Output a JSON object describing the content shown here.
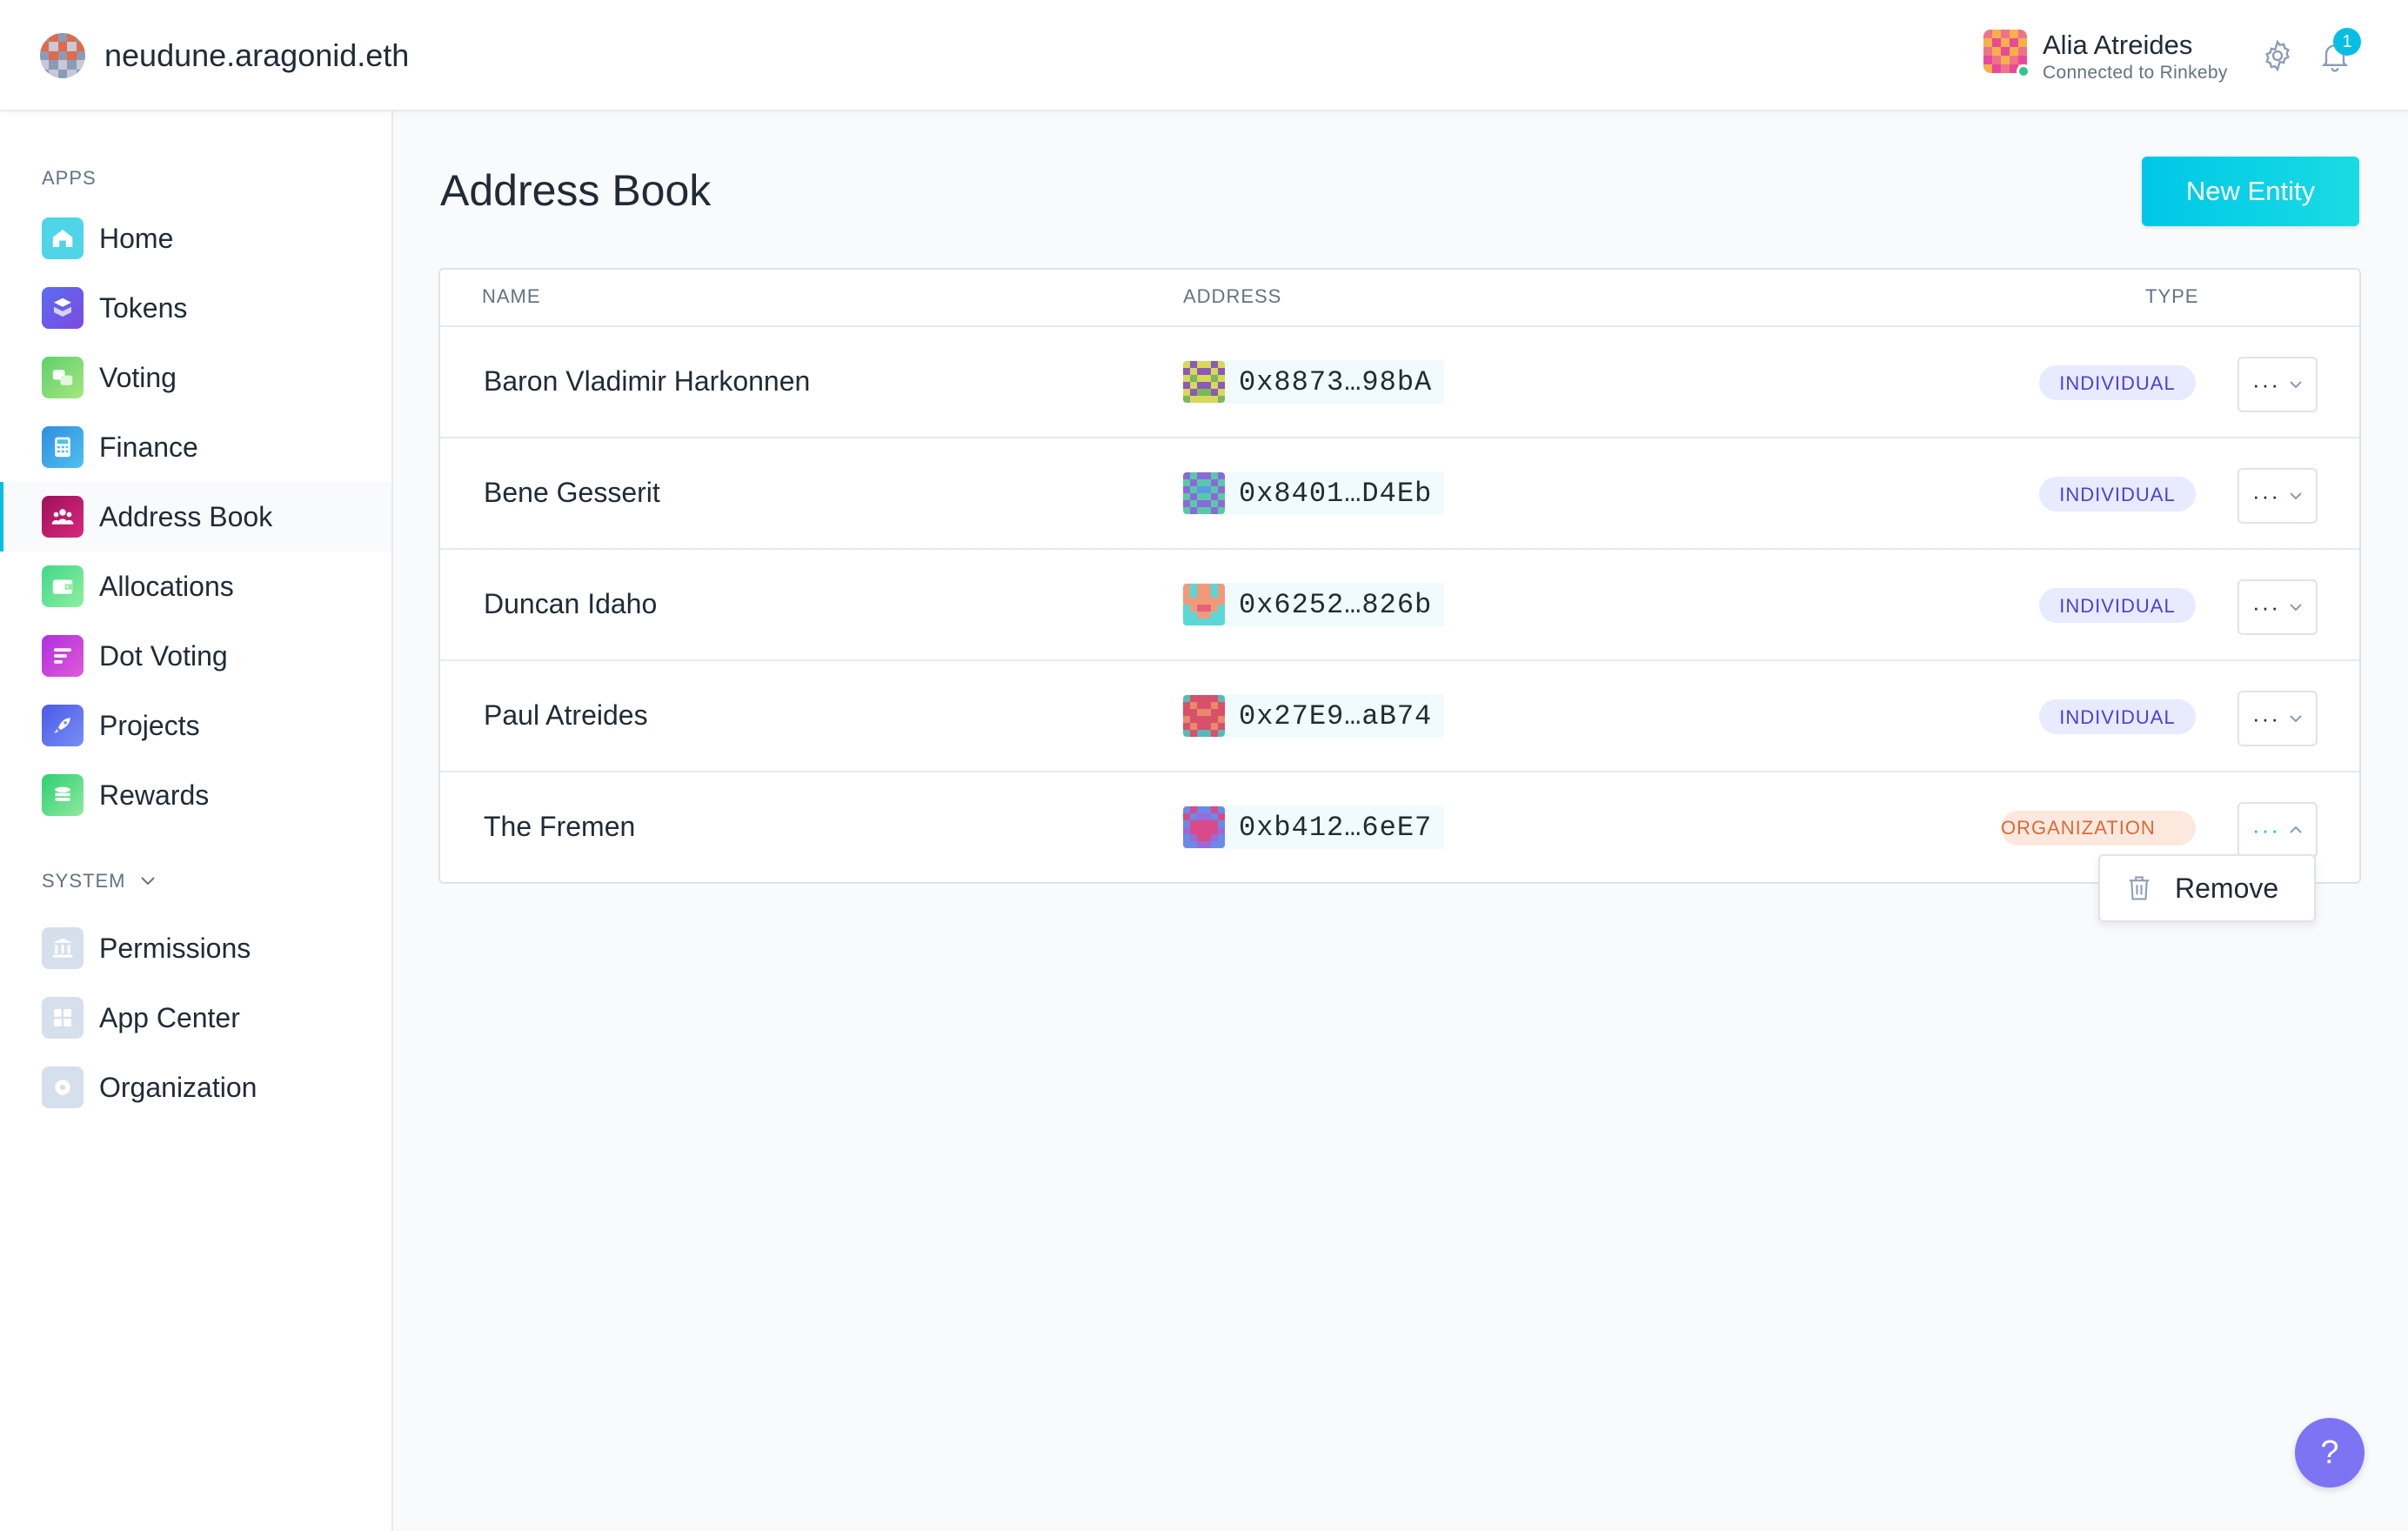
{
  "header": {
    "org_name": "neudune.aragonid.eth",
    "account_name": "Alia Atreides",
    "account_status": "Connected to Rinkeby",
    "notification_count": "1"
  },
  "sidebar": {
    "apps_label": "APPS",
    "system_label": "SYSTEM",
    "apps": [
      {
        "label": "Home",
        "icon": "home-icon",
        "color": "#4fd4e8"
      },
      {
        "label": "Tokens",
        "icon": "tokens-icon",
        "color": "#6a5af0"
      },
      {
        "label": "Voting",
        "icon": "voting-icon",
        "color": "#7ddc7a"
      },
      {
        "label": "Finance",
        "icon": "finance-icon",
        "color": "#3fa7e8"
      },
      {
        "label": "Address Book",
        "icon": "address-book-icon",
        "color": "#c0166e"
      },
      {
        "label": "Allocations",
        "icon": "allocations-icon",
        "color": "#4fe08a"
      },
      {
        "label": "Dot Voting",
        "icon": "dot-voting-icon",
        "color": "#c93ce0"
      },
      {
        "label": "Projects",
        "icon": "projects-icon",
        "color": "#5b6cf0"
      },
      {
        "label": "Rewards",
        "icon": "rewards-icon",
        "color": "#3ed67a"
      }
    ],
    "system": [
      {
        "label": "Permissions",
        "icon": "permissions-icon"
      },
      {
        "label": "App Center",
        "icon": "app-center-icon"
      },
      {
        "label": "Organization",
        "icon": "organization-icon"
      }
    ],
    "active": "Address Book"
  },
  "main": {
    "title": "Address Book",
    "new_button": "New Entity",
    "columns": {
      "name": "NAME",
      "address": "ADDRESS",
      "type": "TYPE"
    },
    "rows": [
      {
        "name": "Baron Vladimir Harkonnen",
        "address": "0x8873…98bA",
        "type": "INDIVIDUAL"
      },
      {
        "name": "Bene Gesserit",
        "address": "0x8401…D4Eb",
        "type": "INDIVIDUAL"
      },
      {
        "name": "Duncan Idaho",
        "address": "0x6252…826b",
        "type": "INDIVIDUAL"
      },
      {
        "name": "Paul Atreides",
        "address": "0x27E9…aB74",
        "type": "INDIVIDUAL"
      },
      {
        "name": "The Fremen",
        "address": "0xb412…6eE7",
        "type": "ORGANIZATION"
      }
    ],
    "context_menu": {
      "remove_label": "Remove"
    }
  },
  "help_label": "?",
  "colors": {
    "accent": "#08bee5",
    "individual_tag": "#4c3fd6",
    "organization_tag": "#d86b35"
  }
}
